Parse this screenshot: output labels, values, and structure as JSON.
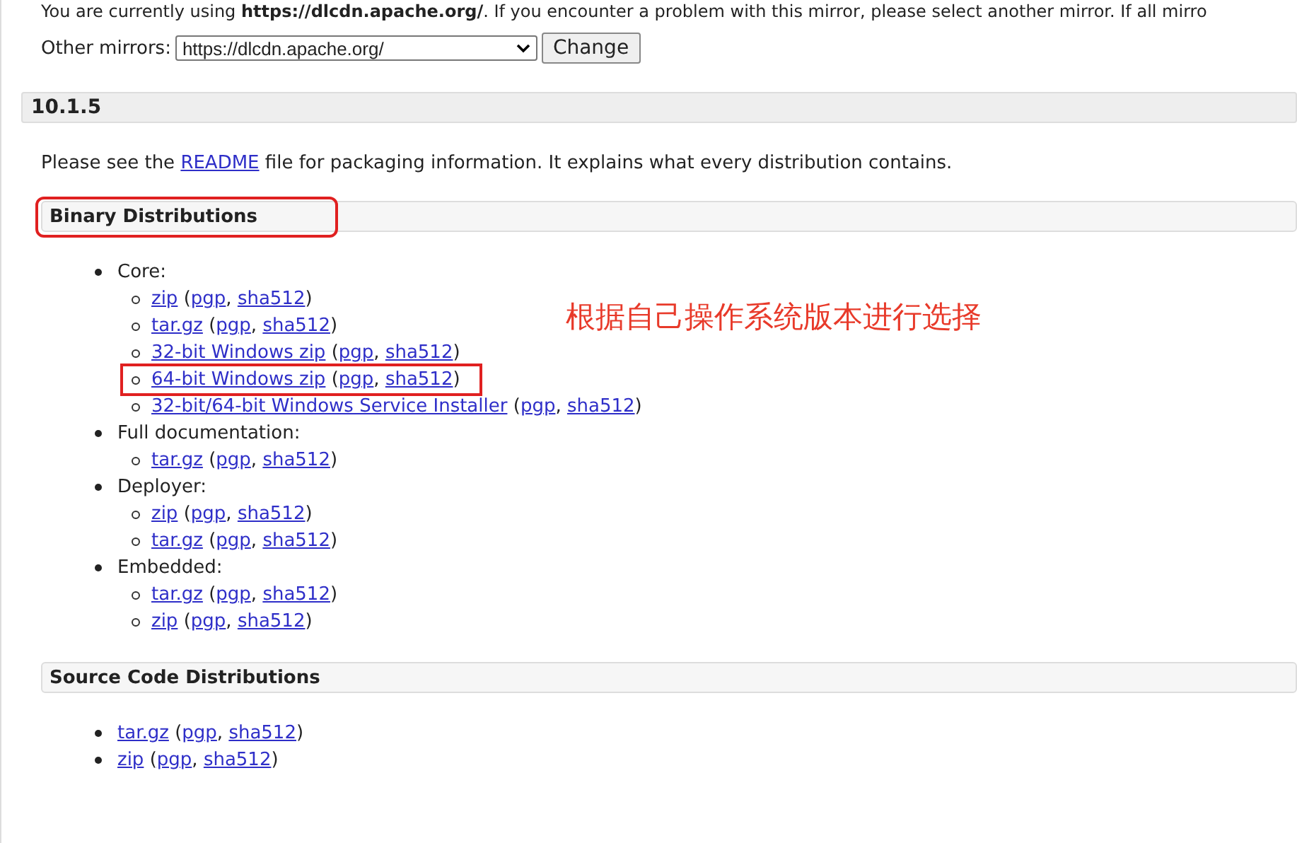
{
  "top_notice": {
    "before": "You are currently using ",
    "url": "https://dlcdn.apache.org/",
    "after": ". If you encounter a problem with this mirror, please select another mirror. If all mirro"
  },
  "mirror_label": "Other mirrors:",
  "mirror_select": "https://dlcdn.apache.org/",
  "change_button": "Change",
  "version": "10.1.5",
  "readme": {
    "before": "Please see the ",
    "link": "README",
    "after": " file for packaging information. It explains what every distribution contains."
  },
  "annotation_note": "根据自己操作系统版本进行选择",
  "sections": [
    {
      "title": "Binary Distributions",
      "annotated": true,
      "groups": [
        {
          "label": "Core:",
          "items": [
            {
              "annotated": false,
              "segments": [
                {
                  "kind": "link",
                  "text": "zip"
                },
                {
                  "kind": "text",
                  "text": " ("
                },
                {
                  "kind": "link",
                  "text": "pgp"
                },
                {
                  "kind": "text",
                  "text": ", "
                },
                {
                  "kind": "link",
                  "text": "sha512"
                },
                {
                  "kind": "text",
                  "text": ")"
                }
              ]
            },
            {
              "annotated": false,
              "segments": [
                {
                  "kind": "link",
                  "text": "tar.gz"
                },
                {
                  "kind": "text",
                  "text": " ("
                },
                {
                  "kind": "link",
                  "text": "pgp"
                },
                {
                  "kind": "text",
                  "text": ", "
                },
                {
                  "kind": "link",
                  "text": "sha512"
                },
                {
                  "kind": "text",
                  "text": ")"
                }
              ]
            },
            {
              "annotated": false,
              "segments": [
                {
                  "kind": "link",
                  "text": "32-bit Windows zip"
                },
                {
                  "kind": "text",
                  "text": " ("
                },
                {
                  "kind": "link",
                  "text": "pgp"
                },
                {
                  "kind": "text",
                  "text": ", "
                },
                {
                  "kind": "link",
                  "text": "sha512"
                },
                {
                  "kind": "text",
                  "text": ")"
                }
              ]
            },
            {
              "annotated": true,
              "segments": [
                {
                  "kind": "link",
                  "text": "64-bit Windows zip"
                },
                {
                  "kind": "text",
                  "text": " ("
                },
                {
                  "kind": "link",
                  "text": "pgp"
                },
                {
                  "kind": "text",
                  "text": ", "
                },
                {
                  "kind": "link",
                  "text": "sha512"
                },
                {
                  "kind": "text",
                  "text": ")"
                }
              ]
            },
            {
              "annotated": false,
              "segments": [
                {
                  "kind": "link",
                  "text": "32-bit/64-bit Windows Service Installer"
                },
                {
                  "kind": "text",
                  "text": " ("
                },
                {
                  "kind": "link",
                  "text": "pgp"
                },
                {
                  "kind": "text",
                  "text": ", "
                },
                {
                  "kind": "link",
                  "text": "sha512"
                },
                {
                  "kind": "text",
                  "text": ")"
                }
              ]
            }
          ]
        },
        {
          "label": "Full documentation:",
          "items": [
            {
              "annotated": false,
              "segments": [
                {
                  "kind": "link",
                  "text": "tar.gz"
                },
                {
                  "kind": "text",
                  "text": " ("
                },
                {
                  "kind": "link",
                  "text": "pgp"
                },
                {
                  "kind": "text",
                  "text": ", "
                },
                {
                  "kind": "link",
                  "text": "sha512"
                },
                {
                  "kind": "text",
                  "text": ")"
                }
              ]
            }
          ]
        },
        {
          "label": "Deployer:",
          "items": [
            {
              "annotated": false,
              "segments": [
                {
                  "kind": "link",
                  "text": "zip"
                },
                {
                  "kind": "text",
                  "text": " ("
                },
                {
                  "kind": "link",
                  "text": "pgp"
                },
                {
                  "kind": "text",
                  "text": ", "
                },
                {
                  "kind": "link",
                  "text": "sha512"
                },
                {
                  "kind": "text",
                  "text": ")"
                }
              ]
            },
            {
              "annotated": false,
              "segments": [
                {
                  "kind": "link",
                  "text": "tar.gz"
                },
                {
                  "kind": "text",
                  "text": " ("
                },
                {
                  "kind": "link",
                  "text": "pgp"
                },
                {
                  "kind": "text",
                  "text": ", "
                },
                {
                  "kind": "link",
                  "text": "sha512"
                },
                {
                  "kind": "text",
                  "text": ")"
                }
              ]
            }
          ]
        },
        {
          "label": "Embedded:",
          "items": [
            {
              "annotated": false,
              "segments": [
                {
                  "kind": "link",
                  "text": "tar.gz"
                },
                {
                  "kind": "text",
                  "text": " ("
                },
                {
                  "kind": "link",
                  "text": "pgp"
                },
                {
                  "kind": "text",
                  "text": ", "
                },
                {
                  "kind": "link",
                  "text": "sha512"
                },
                {
                  "kind": "text",
                  "text": ")"
                }
              ]
            },
            {
              "annotated": false,
              "segments": [
                {
                  "kind": "link",
                  "text": "zip"
                },
                {
                  "kind": "text",
                  "text": " ("
                },
                {
                  "kind": "link",
                  "text": "pgp"
                },
                {
                  "kind": "text",
                  "text": ", "
                },
                {
                  "kind": "link",
                  "text": "sha512"
                },
                {
                  "kind": "text",
                  "text": ")"
                }
              ]
            }
          ]
        }
      ]
    },
    {
      "title": "Source Code Distributions",
      "annotated": false,
      "items": [
        {
          "annotated": false,
          "segments": [
            {
              "kind": "link",
              "text": "tar.gz"
            },
            {
              "kind": "text",
              "text": " ("
            },
            {
              "kind": "link",
              "text": "pgp"
            },
            {
              "kind": "text",
              "text": ", "
            },
            {
              "kind": "link",
              "text": "sha512"
            },
            {
              "kind": "text",
              "text": ")"
            }
          ]
        },
        {
          "annotated": false,
          "segments": [
            {
              "kind": "link",
              "text": "zip"
            },
            {
              "kind": "text",
              "text": " ("
            },
            {
              "kind": "link",
              "text": "pgp"
            },
            {
              "kind": "text",
              "text": ", "
            },
            {
              "kind": "link",
              "text": "sha512"
            },
            {
              "kind": "text",
              "text": ")"
            }
          ]
        }
      ]
    }
  ]
}
